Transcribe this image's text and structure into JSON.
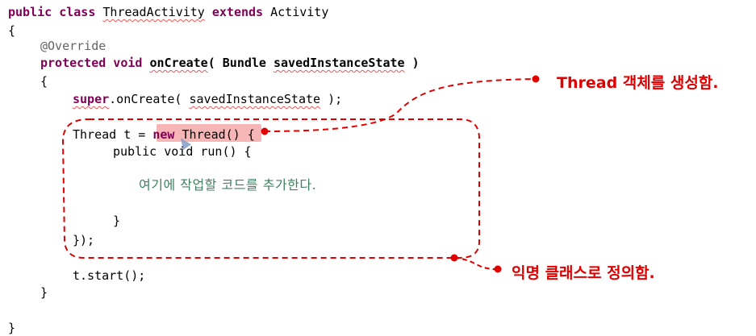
{
  "code": {
    "l1": {
      "kw1": "public class ",
      "cls": "ThreadActivity",
      "kw2": " extends ",
      "base": "Activity"
    },
    "l2": "{",
    "l3": "@Override",
    "l4": {
      "kw": "protected void ",
      "method": "onCreate",
      "open": "( Bundle ",
      "param": "savedInstanceState",
      " close": " )",
      "close": " )"
    },
    "l5": "{",
    "l6": {
      "kw": "super",
      "rest": ".onCreate( ",
      "param": "savedInstanceState",
      "tail": " );"
    },
    "l7": {
      "a": "Thread t = ",
      "kw": "new",
      "b": " Thread() ",
      "brace": "{"
    },
    "l8": {
      "a": "public vo",
      "b": "i",
      "c": "d run() {"
    },
    "comment": "여기에 작업할 코드를 추가한다.",
    "l9": "}",
    "l10": "});",
    "l11": "t.start();",
    "l12": "}",
    "l13": "}"
  },
  "callouts": {
    "top": "Thread 객체를 생성함.",
    "bottom": "익명 클래스로 정의함."
  },
  "colors": {
    "accent": "#e00000",
    "keyword": "#7f0055",
    "comment": "#3f7f5f",
    "highlight": "#f7b6b6"
  }
}
